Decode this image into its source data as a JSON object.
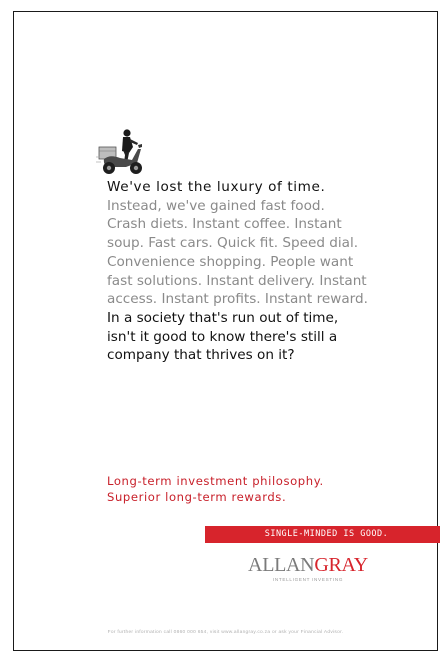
{
  "illustration": {
    "icon": "scooter-rider-icon"
  },
  "body_copy": {
    "lead": "We've lost the luxury of time.",
    "grey_lines": [
      "Instead, we've gained fast food.",
      "Crash diets. Instant coffee. Instant",
      "soup. Fast cars. Quick fit. Speed dial.",
      "Convenience shopping. People want",
      "fast solutions. Instant delivery. Instant",
      "access. Instant profits. Instant reward."
    ],
    "closing_lines": [
      "In a society that's run out of time,",
      "isn't it good to know there's still a",
      "company that thrives on it?"
    ]
  },
  "tagline": {
    "line1": "Long-term investment philosophy.",
    "line2": "Superior long-term rewards."
  },
  "banner": {
    "text": "SINGLE-MINDED IS GOOD.",
    "color": "#d7242c"
  },
  "logo": {
    "part1": "ALLAN",
    "part2": "GRAY",
    "subtitle": "INTELLIGENT INVESTING",
    "colors": {
      "gray": "#7a7a7a",
      "red": "#d7242c"
    }
  },
  "footer": {
    "text": "For further information call 0860 000 654, visit www.allangray.co.za or ask your Financial Advisor."
  }
}
